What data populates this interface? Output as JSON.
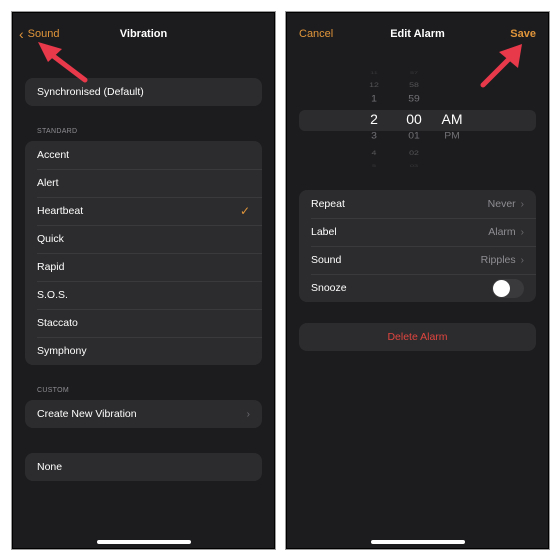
{
  "left_screen": {
    "nav": {
      "back_label": "Sound",
      "title": "Vibration"
    },
    "default_option": "Synchronised (Default)",
    "standard": {
      "header": "STANDARD",
      "items": [
        {
          "label": "Accent",
          "selected": false
        },
        {
          "label": "Alert",
          "selected": false
        },
        {
          "label": "Heartbeat",
          "selected": true
        },
        {
          "label": "Quick",
          "selected": false
        },
        {
          "label": "Rapid",
          "selected": false
        },
        {
          "label": "S.O.S.",
          "selected": false
        },
        {
          "label": "Staccato",
          "selected": false
        },
        {
          "label": "Symphony",
          "selected": false
        }
      ]
    },
    "custom": {
      "header": "CUSTOM",
      "create_label": "Create New Vibration"
    },
    "none_label": "None"
  },
  "right_screen": {
    "nav": {
      "cancel_label": "Cancel",
      "title": "Edit Alarm",
      "save_label": "Save"
    },
    "time_picker": {
      "hours": [
        "11",
        "12",
        "1",
        "2",
        "3",
        "4",
        "5"
      ],
      "minutes": [
        "57",
        "58",
        "59",
        "00",
        "01",
        "02",
        "03"
      ],
      "periods": [
        "AM",
        "PM"
      ],
      "selected": {
        "hour": "2",
        "minute": "00",
        "period": "AM"
      }
    },
    "settings": [
      {
        "label": "Repeat",
        "value": "Never"
      },
      {
        "label": "Label",
        "value": "Alarm"
      },
      {
        "label": "Sound",
        "value": "Ripples"
      }
    ],
    "snooze": {
      "label": "Snooze",
      "on": false
    },
    "delete_label": "Delete Alarm"
  },
  "colors": {
    "accent": "#e0953a",
    "destructive": "#e0453f",
    "background": "#1c1c1e",
    "cell": "#2c2c2e",
    "annotation_arrow": "#e8394b"
  }
}
